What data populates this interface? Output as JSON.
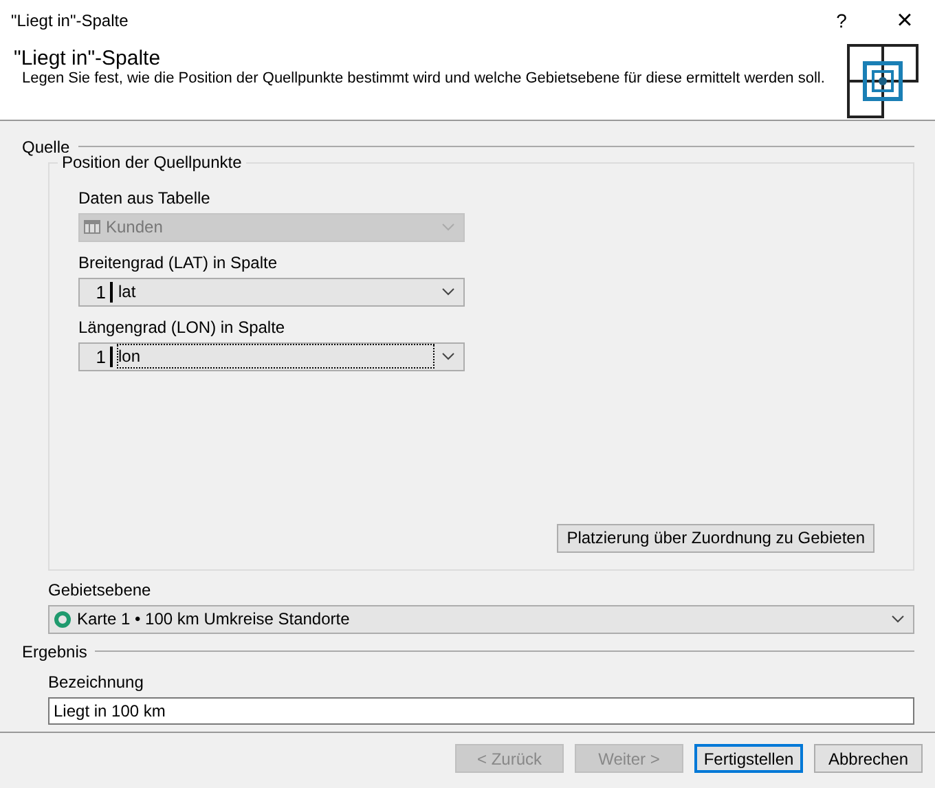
{
  "window": {
    "title": "\"Liegt in\"-Spalte",
    "help": "?",
    "close": "×"
  },
  "header": {
    "title": "\"Liegt in\"-Spalte",
    "description": "Legen Sie fest, wie die Position der Quellpunkte bestimmt wird und welche Gebietsebene für diese ermittelt werden soll."
  },
  "source": {
    "title": "Quelle",
    "group_title": "Position der Quellpunkte",
    "fields": [
      {
        "label": "Daten aus Tabelle",
        "kind": "table",
        "value": "Kunden",
        "disabled": true,
        "focused": false
      },
      {
        "label": "Breitengrad (LAT) in Spalte",
        "kind": "column",
        "index": "1",
        "value": "lat",
        "disabled": false,
        "focused": false
      },
      {
        "label": "Längengrad (LON) in Spalte",
        "kind": "column",
        "index": "1",
        "value": "lon",
        "disabled": false,
        "focused": true
      }
    ],
    "placement_button": "Platzierung über Zuordnung zu Gebieten",
    "area_label": "Gebietsebene",
    "area_value": "Karte 1 • 100 km Umkreise Standorte"
  },
  "result": {
    "title": "Ergebnis",
    "label": "Bezeichnung",
    "value": "Liegt in 100 km"
  },
  "buttons": [
    {
      "label": "< Zurück",
      "disabled": true,
      "default": false
    },
    {
      "label": "Weiter >",
      "disabled": true,
      "default": false
    },
    {
      "label": "Fertigstellen",
      "disabled": false,
      "default": true
    },
    {
      "label": "Abbrechen",
      "disabled": false,
      "default": false
    }
  ]
}
